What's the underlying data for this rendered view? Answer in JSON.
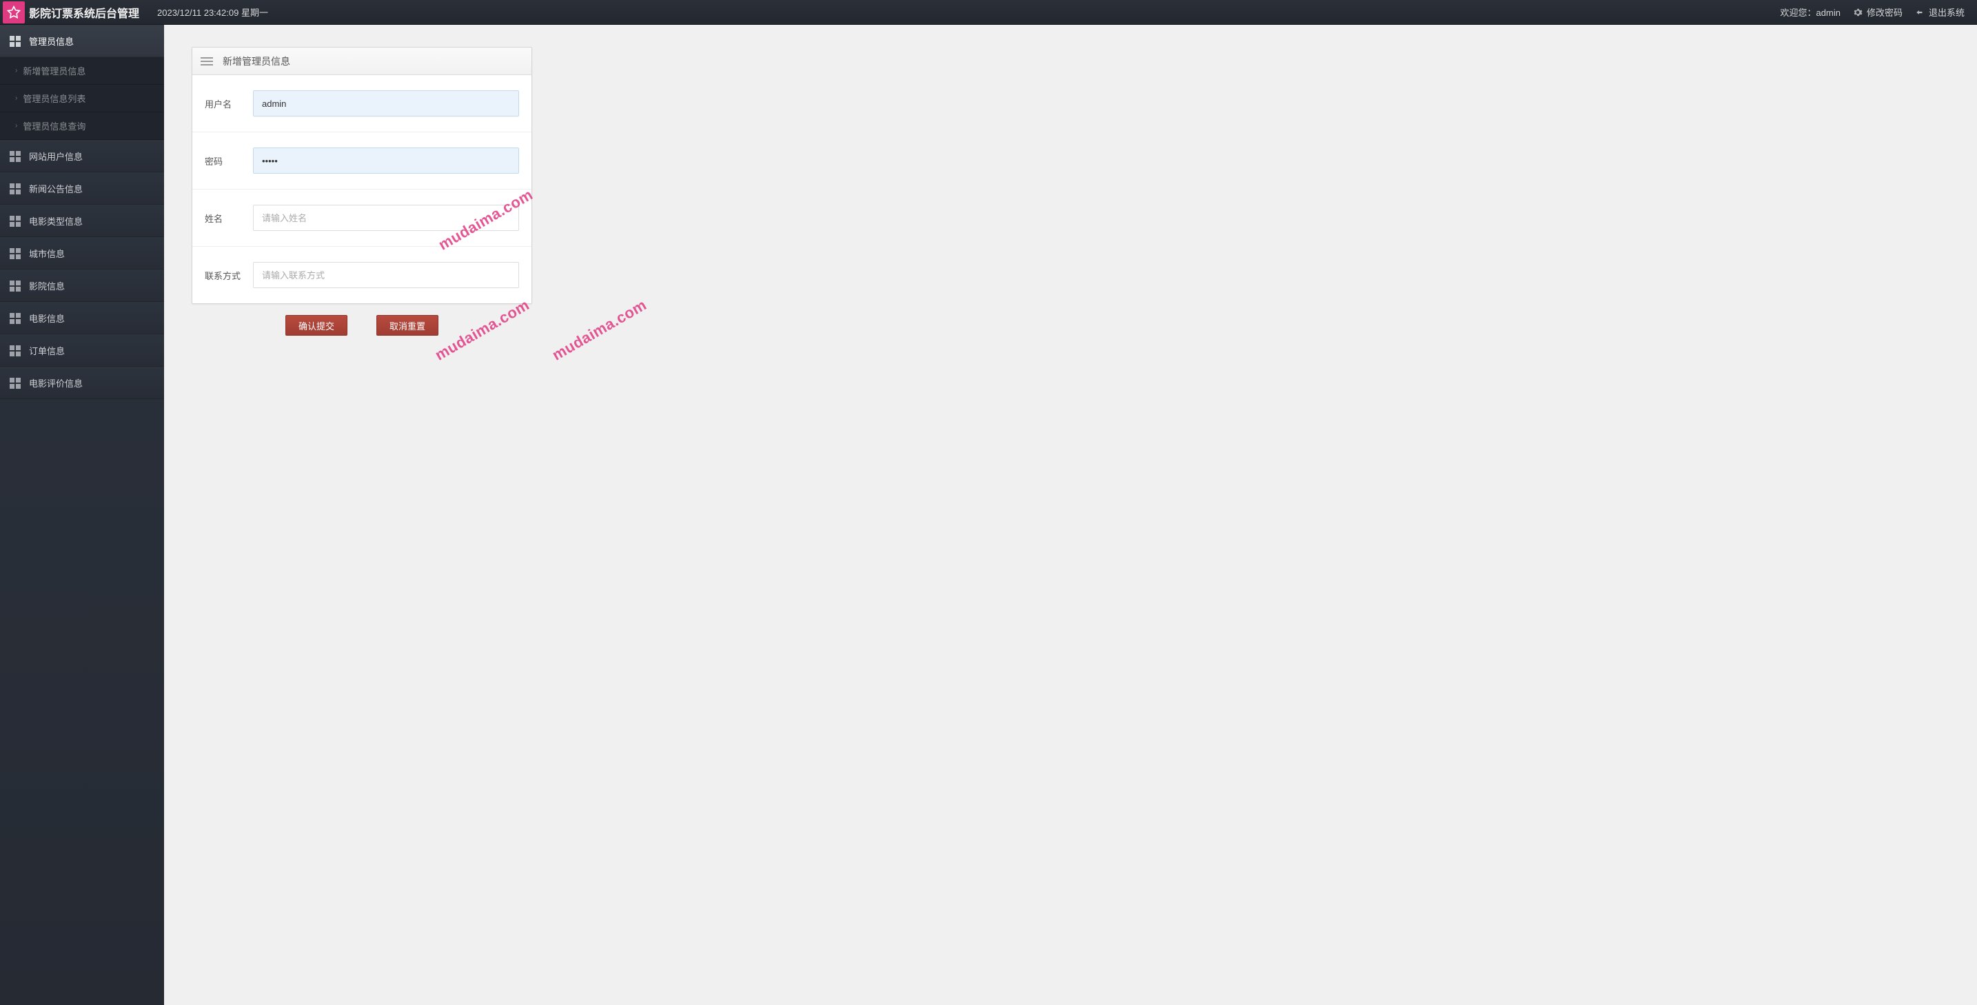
{
  "header": {
    "app_title": "影院订票系统后台管理",
    "datetime": "2023/12/11 23:42:09 星期一",
    "welcome": "欢迎您：admin",
    "change_pwd": "修改密码",
    "logout": "退出系统"
  },
  "sidebar": {
    "items": [
      {
        "label": "管理员信息",
        "active": true,
        "expanded": true
      },
      {
        "label": "网站用户信息"
      },
      {
        "label": "新闻公告信息"
      },
      {
        "label": "电影类型信息"
      },
      {
        "label": "城市信息"
      },
      {
        "label": "影院信息"
      },
      {
        "label": "电影信息"
      },
      {
        "label": "订单信息"
      },
      {
        "label": "电影评价信息"
      }
    ],
    "subitems": [
      {
        "label": "新增管理员信息"
      },
      {
        "label": "管理员信息列表"
      },
      {
        "label": "管理员信息查询"
      }
    ]
  },
  "panel": {
    "title": "新增管理员信息"
  },
  "form": {
    "username_label": "用户名",
    "username_value": "admin",
    "password_label": "密码",
    "password_value": "•••••",
    "name_label": "姓名",
    "name_placeholder": "请输入姓名",
    "contact_label": "联系方式",
    "contact_placeholder": "请输入联系方式"
  },
  "buttons": {
    "submit": "确认提交",
    "reset": "取消重置"
  },
  "watermark": "mudaima.com"
}
